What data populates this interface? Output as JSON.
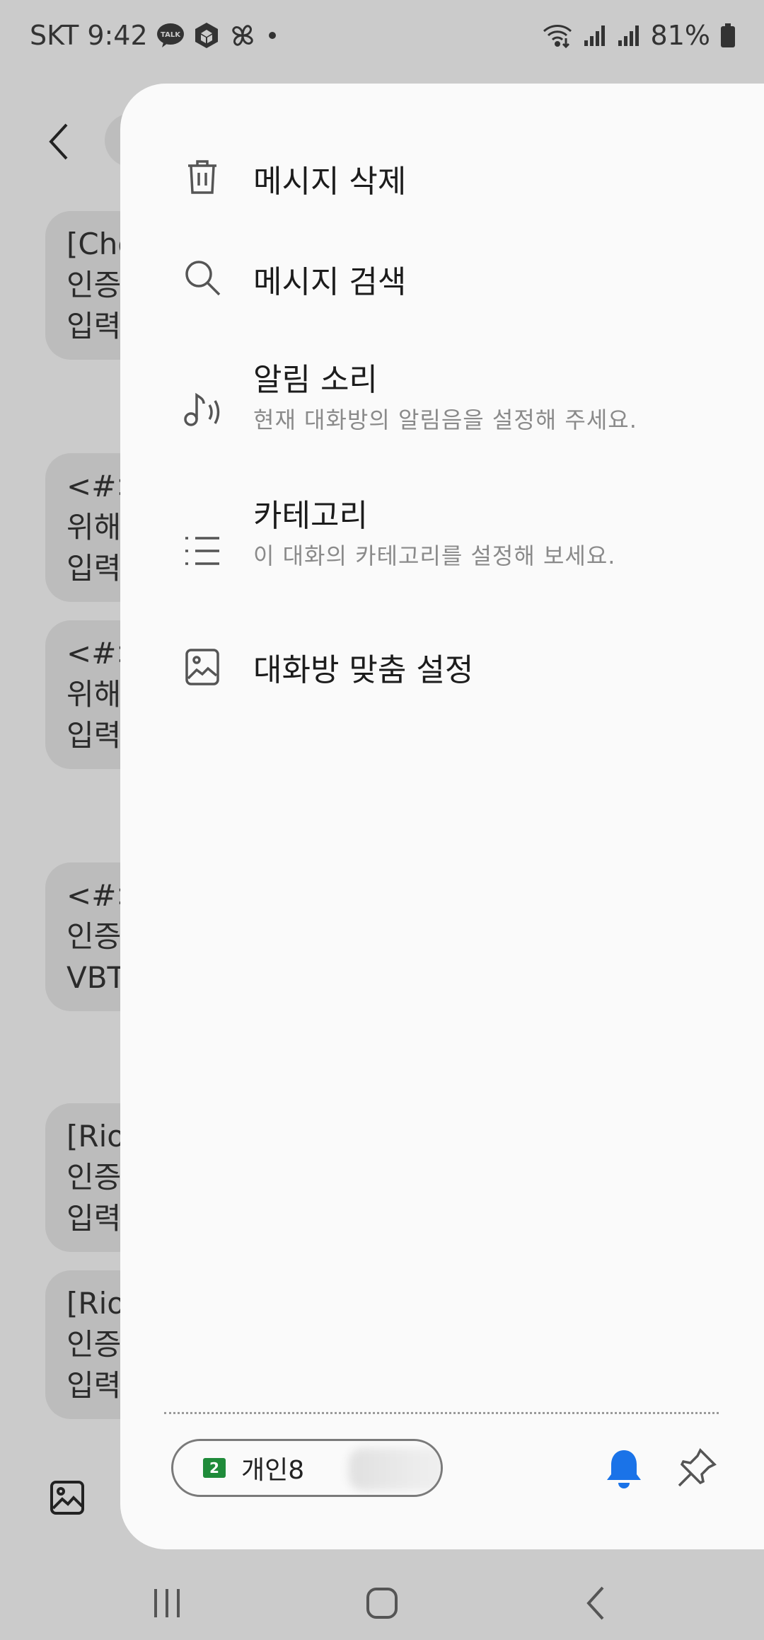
{
  "status_bar": {
    "carrier": "SKT",
    "time": "9:42",
    "battery": "81%",
    "left_icons": [
      "kakaotalk-icon",
      "cube-icon",
      "pinwheel-icon",
      "dot-icon"
    ],
    "right_icons": [
      "wifi-icon",
      "signal-icon",
      "signal-icon",
      "battery-icon"
    ]
  },
  "background_chat": {
    "bubbles": [
      {
        "line1": "[Cho",
        "line2": "인증",
        "line3": "입력"
      },
      {
        "line1": "<#>",
        "line2": "위해",
        "line3": "입력"
      },
      {
        "line1": "<#>",
        "line2": "위해",
        "line3": "입력"
      },
      {
        "line1": "<#>",
        "line2": "인증",
        "line3": "VBT"
      },
      {
        "line1": "[Rio",
        "line2": "인증",
        "line3": "입력"
      },
      {
        "line1": "[Rio",
        "line2": "인증",
        "line3": "입력"
      }
    ]
  },
  "drawer": {
    "menu": [
      {
        "title": "메시지 삭제",
        "subtitle": "",
        "icon": "trash-icon"
      },
      {
        "title": "메시지 검색",
        "subtitle": "",
        "icon": "search-icon"
      },
      {
        "title": "알림 소리",
        "subtitle": "현재 대화방의 알림음을 설정해 주세요.",
        "icon": "music-note-icon"
      },
      {
        "title": "카테고리",
        "subtitle": "이 대화의 카테고리를 설정해 보세요.",
        "icon": "list-icon"
      },
      {
        "title": "대화방 맞춤 설정",
        "subtitle": "",
        "icon": "image-icon"
      }
    ],
    "footer": {
      "sim_number": "2",
      "sim_label": "개인8",
      "bell_color": "#1a73e8"
    }
  },
  "nav_bar": {
    "buttons": [
      "recents-icon",
      "home-icon",
      "back-icon"
    ]
  }
}
